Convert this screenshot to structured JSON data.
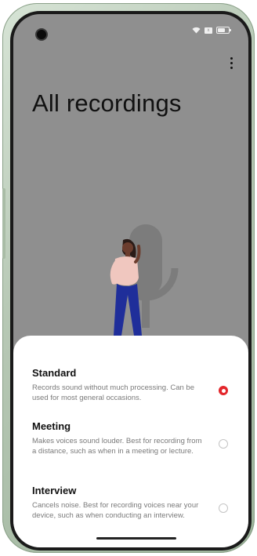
{
  "page": {
    "title": "All recordings"
  },
  "status_bar": {
    "icons": [
      "camera-icon",
      "wifi-icon",
      "sim-icon",
      "battery-icon"
    ],
    "sim_label": "x"
  },
  "toolbar": {
    "more_icon": "more-vert-icon"
  },
  "illustration": {
    "description_icon": "woman-with-microphone-illustration"
  },
  "recording_modes": {
    "selected": "Standard",
    "options": [
      {
        "title": "Standard",
        "description": "Records sound without much processing. Can be used for most general occasions.",
        "selected": true
      },
      {
        "title": "Meeting",
        "description": "Makes voices sound louder. Best for recording from a distance, such as when in a meeting or lecture.",
        "selected": false
      },
      {
        "title": "Interview",
        "description": "Cancels noise. Best for recording voices near your device, such as when conducting an interview.",
        "selected": false
      }
    ]
  },
  "colors": {
    "accent": "#e3262b",
    "scrim": "#8f8f8f",
    "sheet_background": "#ffffff",
    "frame": "#b7c8b5"
  }
}
